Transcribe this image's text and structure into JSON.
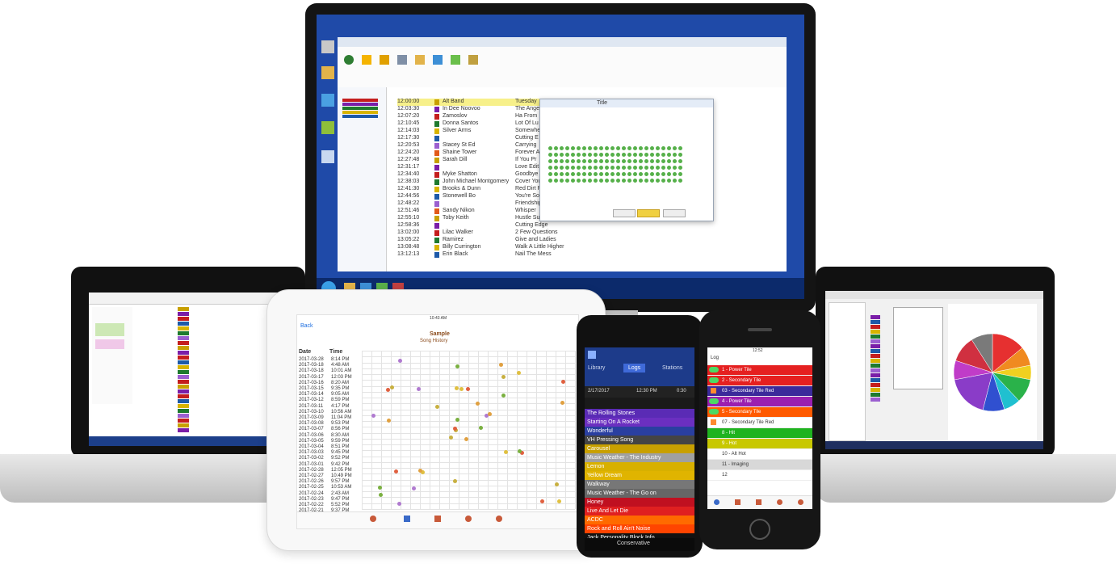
{
  "monitor": {
    "dialog_title": "Title",
    "rows": [
      {
        "time": "12:00:00",
        "artist": "Alt Band",
        "song": "Tuesday"
      },
      {
        "time": "12:03:30",
        "artist": "In Dee Noovoo",
        "song": "The Ange"
      },
      {
        "time": "12:07:20",
        "artist": "Zamoslov",
        "song": "Ha From"
      },
      {
        "time": "12:10:45",
        "artist": "Donna Santos",
        "song": "Lot Of Lu"
      },
      {
        "time": "12:14:03",
        "artist": "Silver Arms",
        "song": "Somewhe"
      },
      {
        "time": "12:17:30",
        "artist": "",
        "song": "Cutting E"
      },
      {
        "time": "12:20:53",
        "artist": "Stacey St Ed",
        "song": "Carrying"
      },
      {
        "time": "12:24:20",
        "artist": "Shaine Tower",
        "song": "Forever A"
      },
      {
        "time": "12:27:48",
        "artist": "Sarah Dill",
        "song": "If You Pr"
      },
      {
        "time": "12:31:17",
        "artist": "",
        "song": "Love Edit"
      },
      {
        "time": "12:34:40",
        "artist": "Myke Shatton",
        "song": "Goodbye"
      },
      {
        "time": "12:38:03",
        "artist": "John Michael Montgomery",
        "song": "Cover You"
      },
      {
        "time": "12:41:30",
        "artist": "Brooks & Dunn",
        "song": "Red Dirt R"
      },
      {
        "time": "12:44:56",
        "artist": "Stonewell Bo",
        "song": "You're So"
      },
      {
        "time": "12:48:22",
        "artist": "",
        "song": "Friendship"
      },
      {
        "time": "12:51:46",
        "artist": "Sandy Nikon",
        "song": "Whisper"
      },
      {
        "time": "12:55:10",
        "artist": "Toby Keith",
        "song": "Hustle Sun"
      },
      {
        "time": "12:58:36",
        "artist": "",
        "song": "Cutting Edge"
      },
      {
        "time": "13:02:00",
        "artist": "Lilac Walker",
        "song": "2 Few Questions"
      },
      {
        "time": "13:05:22",
        "artist": "Ramirez",
        "song": "Give and Ladies"
      },
      {
        "time": "13:08:48",
        "artist": "Billy Currington",
        "song": "Walk A Little Higher"
      },
      {
        "time": "13:12:13",
        "artist": "Erin Black",
        "song": "Nail The Mess"
      }
    ]
  },
  "tablet": {
    "back_label": "Back",
    "status_center": "10:43 AM",
    "title": "Sample",
    "subtitle": "Song History",
    "col_date": "Date",
    "col_time": "Time",
    "dates": [
      "2017-03-28",
      "2017-03-18",
      "2017-03-18",
      "2017-03-17",
      "2017-03-16",
      "2017-03-15",
      "2017-03-14",
      "2017-03-12",
      "2017-03-11",
      "2017-03-10",
      "2017-03-09",
      "2017-03-08",
      "2017-03-07",
      "2017-03-06",
      "2017-03-05",
      "2017-03-04",
      "2017-03-03",
      "2017-03-02",
      "2017-03-01",
      "2017-02-28",
      "2017-02-27",
      "2017-02-26",
      "2017-02-25",
      "2017-02-24",
      "2017-02-23",
      "2017-02-22",
      "2017-02-21"
    ],
    "times": [
      "8:14 PM",
      "4:48 AM",
      "10:01 AM",
      "12:03 PM",
      "8:20 AM",
      "9:35 PM",
      "9:05 AM",
      "8:59 PM",
      "4:17 PM",
      "10:56 AM",
      "11:04 PM",
      "9:53 PM",
      "8:56 PM",
      "8:30 AM",
      "9:59 PM",
      "8:51 PM",
      "9:45 PM",
      "9:52 PM",
      "9:42 PM",
      "12:05 PM",
      "10:49 PM",
      "9:57 PM",
      "10:53 AM",
      "2:43 AM",
      "9:47 PM",
      "5:52 PM",
      "9:37 PM"
    ]
  },
  "android": {
    "tabs": [
      "Library",
      "Logs",
      "Stations"
    ],
    "date": "2/17/2017",
    "time": "12:30 PM",
    "zoom": "0:30",
    "songs": [
      {
        "title": "The Rolling Stones",
        "color": "#5a2bb5"
      },
      {
        "title": "Starting On A Rocket",
        "color": "#6b2fc0"
      },
      {
        "title": "Wonderful",
        "color": "#2a3fa0"
      },
      {
        "title": "VH Pressing Song",
        "color": "#444444"
      },
      {
        "title": "Carousel",
        "color": "#c8a000"
      },
      {
        "title": "Music Weather - The Industry",
        "color": "#a0a0a0"
      },
      {
        "title": "Lemon",
        "color": "#d8b000"
      },
      {
        "title": "Yellow Dream",
        "color": "#e0b400"
      },
      {
        "title": "Walkway",
        "color": "#777777"
      },
      {
        "title": "Music Weather - The Go on",
        "color": "#666666"
      },
      {
        "title": "Honey",
        "color": "#c01020"
      },
      {
        "title": "Live And Let Die",
        "color": "#e02020"
      },
      {
        "title": "ACDC",
        "color": "#ff6a00"
      },
      {
        "title": "Rock and Roll Ain't Noise",
        "color": "#ff4400"
      },
      {
        "title": "Jack Personality Block Info",
        "color": "#111111"
      }
    ],
    "bottom_label": "Conservative"
  },
  "iphone": {
    "status_time": "12:52",
    "nav_label": "Log",
    "rows": [
      {
        "text": "1 - Power Tile",
        "color": "#e52020",
        "icon": "toggle"
      },
      {
        "text": "2 - Secondary Tile",
        "color": "#e52020",
        "icon": "toggle"
      },
      {
        "text": "03 - Secondary Tile Red",
        "color": "#3b2a9b",
        "icon": "calendar"
      },
      {
        "text": "4 - Power Tile",
        "color": "#9b1fb0",
        "icon": "toggle"
      },
      {
        "text": "5 - Secondary Tile",
        "color": "#ff5a00",
        "icon": "toggle"
      },
      {
        "text": "07 - Secondary Tile Red",
        "color": "#ffffff",
        "icon": "calendar"
      },
      {
        "text": "8 - Hit",
        "color": "#1fb31f",
        "icon": "none"
      },
      {
        "text": "9 - Hot",
        "color": "#c8c800",
        "icon": "none"
      },
      {
        "text": "10 - Alt Hot",
        "color": "#ffffff",
        "icon": "none"
      },
      {
        "text": "11 - Imaging",
        "color": "#d8d8d8",
        "icon": "none"
      },
      {
        "text": "12",
        "color": "#ffffff",
        "icon": "none"
      }
    ]
  },
  "pie": {
    "slices": [
      {
        "value": 14,
        "color": "#e63030"
      },
      {
        "value": 8,
        "color": "#f08a20"
      },
      {
        "value": 6,
        "color": "#f0d020"
      },
      {
        "value": 10,
        "color": "#2ab24a"
      },
      {
        "value": 7,
        "color": "#20c0d0"
      },
      {
        "value": 9,
        "color": "#3050d0"
      },
      {
        "value": 18,
        "color": "#8a3cc8"
      },
      {
        "value": 8,
        "color": "#c03cc8"
      },
      {
        "value": 11,
        "color": "#d03040"
      },
      {
        "value": 9,
        "color": "#7a7a7a"
      }
    ]
  }
}
